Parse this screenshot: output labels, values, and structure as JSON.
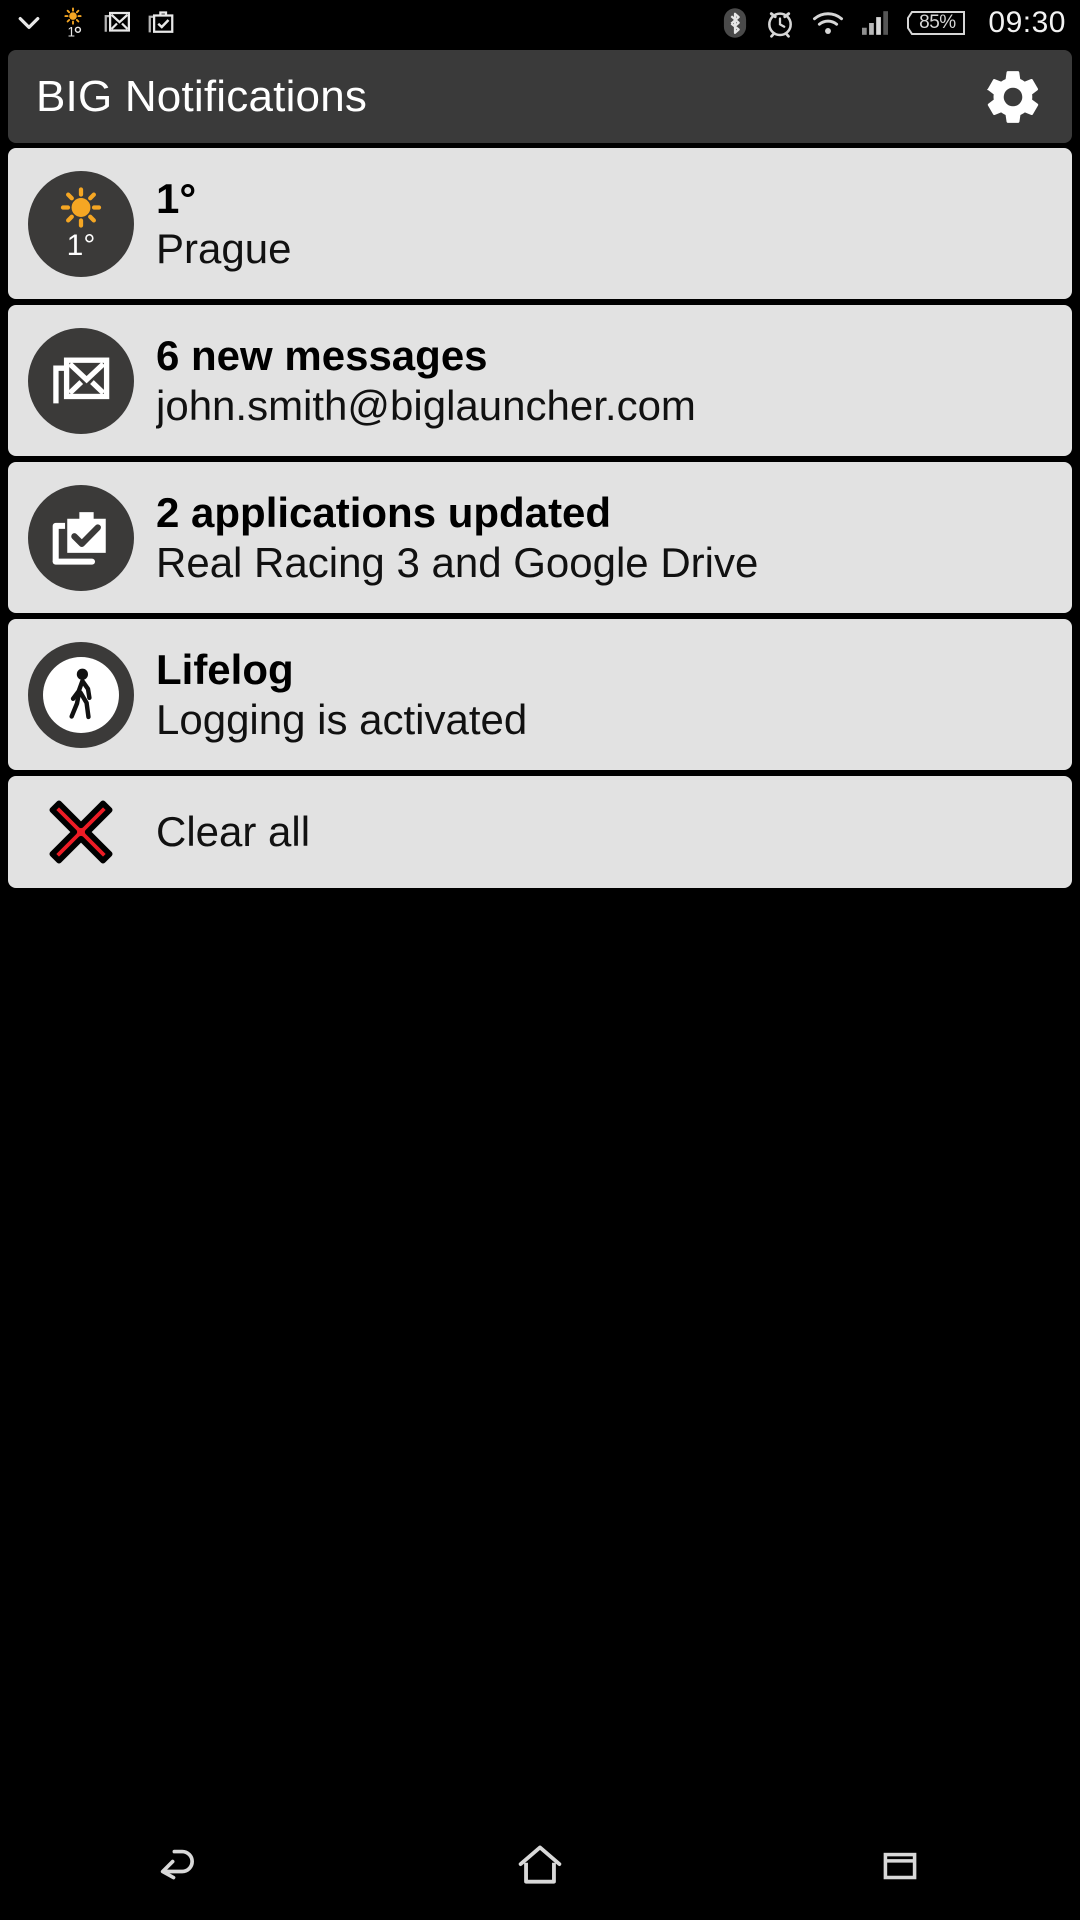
{
  "status_bar": {
    "left_icons": [
      {
        "name": "chevron-down-icon",
        "label": "expand"
      },
      {
        "name": "weather-status-icon",
        "label": "1°"
      },
      {
        "name": "gmail-status-icon",
        "label": "Gmail"
      },
      {
        "name": "play-store-update-status-icon",
        "label": "Updates"
      }
    ],
    "right_icons": [
      {
        "name": "bluetooth-icon",
        "label": "Bluetooth"
      },
      {
        "name": "alarm-icon",
        "label": "Alarm"
      },
      {
        "name": "wifi-icon",
        "label": "Wi-Fi"
      },
      {
        "name": "cellular-signal-icon",
        "label": "Signal"
      }
    ],
    "battery_percent": "85%",
    "clock": "09:30"
  },
  "header": {
    "title": "BIG Notifications",
    "settings_icon": "gear-icon"
  },
  "notifications": [
    {
      "icon": "weather-sun-icon",
      "icon_temp": "1°",
      "title": "1°",
      "subtitle": "Prague"
    },
    {
      "icon": "gmail-icon",
      "title": "6 new messages",
      "subtitle": "john.smith@biglauncher.com"
    },
    {
      "icon": "app-update-icon",
      "title": "2 applications updated",
      "subtitle": "Real Racing 3 and Google Drive"
    },
    {
      "icon": "walking-person-icon",
      "title": "Lifelog",
      "subtitle": "Logging is activated"
    }
  ],
  "clear_all": {
    "icon": "red-x-icon",
    "label": "Clear all"
  },
  "nav_bar": {
    "back": "back-icon",
    "home": "home-icon",
    "recents": "recents-icon"
  },
  "colors": {
    "screen_bg": "#000000",
    "header_bg": "#3a3a3a",
    "card_bg": "#e2e2e2",
    "icon_circle": "#3b3a39",
    "sun_yellow": "#f5a623",
    "clear_red": "#ee1c25",
    "text_light": "#ffffff",
    "text_dark": "#000000"
  }
}
